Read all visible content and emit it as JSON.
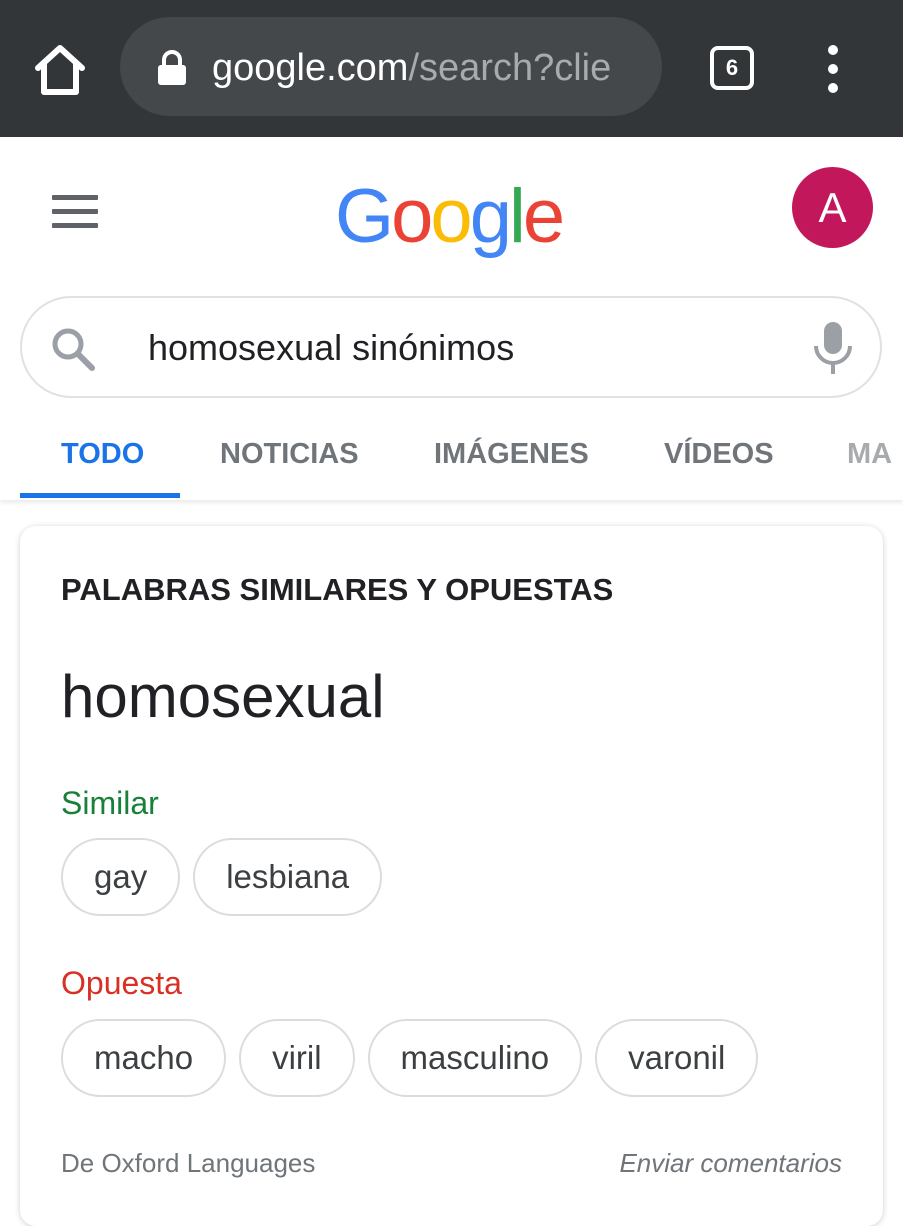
{
  "browser": {
    "url_host": "google.com",
    "url_rest": "/search?clie",
    "tab_count": "6"
  },
  "header": {
    "logo_letters": [
      "G",
      "o",
      "o",
      "g",
      "l",
      "e"
    ],
    "logo_colors": [
      "#4285f4",
      "#ea4335",
      "#fbbc05",
      "#4285f4",
      "#34a853",
      "#ea4335"
    ],
    "avatar_initial": "A",
    "avatar_color": "#c2185b"
  },
  "search": {
    "query": "homosexual sinónimos"
  },
  "tabs": [
    {
      "label": "TODO",
      "active": true
    },
    {
      "label": "NOTICIAS",
      "active": false
    },
    {
      "label": "IMÁGENES",
      "active": false
    },
    {
      "label": "VÍDEOS",
      "active": false
    },
    {
      "label": "MA",
      "active": false
    }
  ],
  "card": {
    "title": "PALABRAS SIMILARES Y OPUESTAS",
    "word": "homosexual",
    "similar_label": "Similar",
    "similar": [
      "gay",
      "lesbiana"
    ],
    "opposite_label": "Opuesta",
    "opposite": [
      "macho",
      "viril",
      "masculino",
      "varonil"
    ],
    "source": "De Oxford Languages",
    "feedback": "Enviar comentarios"
  },
  "colors": {
    "accent": "#1a73e8",
    "similar": "#188038",
    "opposite": "#d93025"
  }
}
